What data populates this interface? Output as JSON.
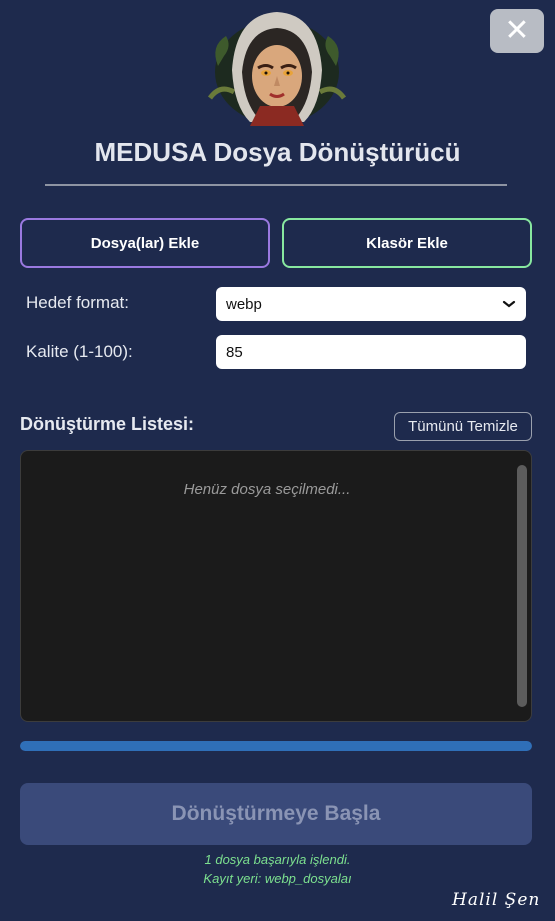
{
  "window": {
    "close_symbol": "✕",
    "title": "MEDUSA Dosya Dönüştürücü",
    "logo_icon": "medusa-hooded-portrait"
  },
  "actions": {
    "add_files_label": "Dosya(lar) Ekle",
    "add_folder_label": "Klasör Ekle",
    "add_files_border_color": "#9a79e0",
    "add_folder_border_color": "#88e8a0"
  },
  "settings": {
    "format_label": "Hedef format:",
    "format_value": "webp",
    "quality_label": "Kalite (1-100):",
    "quality_value": "85"
  },
  "list": {
    "title": "Dönüştürme Listesi:",
    "clear_label": "Tümünü Temizle",
    "placeholder": "Henüz dosya seçilmedi..."
  },
  "progress": {
    "fraction": 1.0,
    "color": "#2f6fb8"
  },
  "start_button": {
    "label": "Dönüştürmeye Başla"
  },
  "status": {
    "line1": "1 dosya başarıyla işlendi.",
    "line2": "Kayıt yeri: webp_dosyalaı"
  },
  "footer": {
    "signature": "Halil Şen"
  }
}
